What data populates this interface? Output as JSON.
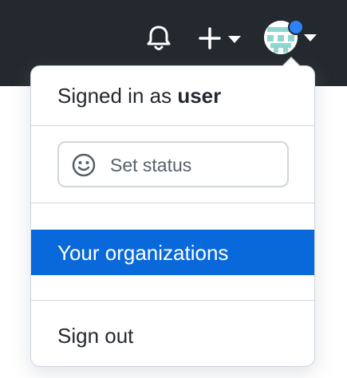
{
  "header": {
    "notifications_icon": "bell-icon",
    "create_icon": "plus-icon",
    "create_caret_icon": "caret-down-icon",
    "avatar_caret_icon": "caret-down-icon",
    "avatar_indicator_color": "#2f81f7",
    "background_color": "#24292f"
  },
  "menu": {
    "signed_in_prefix": "Signed in as",
    "username": "user",
    "set_status_label": "Set status",
    "set_status_icon": "smiley-icon",
    "your_organizations_label": "Your organizations",
    "sign_out_label": "Sign out",
    "highlight_color": "#0969da"
  }
}
